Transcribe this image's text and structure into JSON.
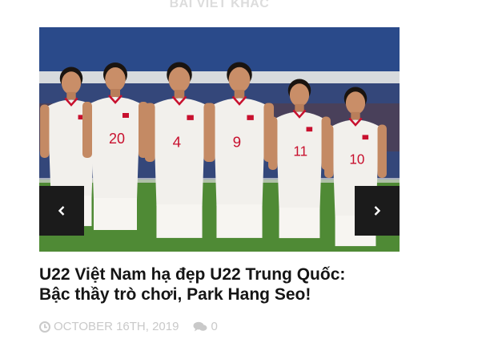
{
  "section": {
    "title": "BÀI VIẾT KHÁC"
  },
  "slider": {
    "prev_icon": "chevron-left-icon",
    "next_icon": "chevron-right-icon",
    "photo": {
      "jersey_numbers": [
        "",
        "20",
        "4",
        "9",
        "11",
        "10"
      ],
      "colors": {
        "jersey": "#f2f0ec",
        "accent": "#c8102e",
        "sky": "#c9d3dc",
        "stands": "#2a4a8a",
        "grass": "#4f8a35"
      }
    }
  },
  "article": {
    "title_line1": "U22 Việt Nam hạ đẹp U22 Trung Quốc:",
    "title_line2": "Bậc thầy trò chơi, Park Hang Seo!",
    "date": "October 16th, 2019",
    "comment_count": "0",
    "icons": {
      "date": "clock-icon",
      "comments": "comments-icon"
    }
  }
}
